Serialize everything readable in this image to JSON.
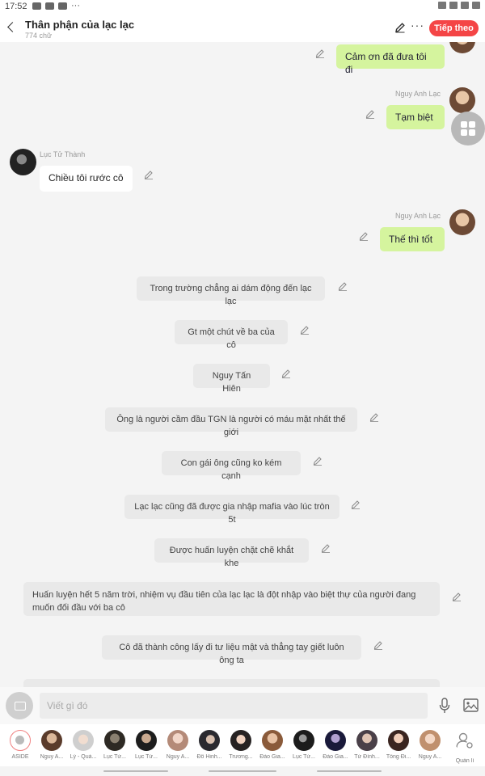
{
  "status_bar": {
    "time": "17:52",
    "more": "···"
  },
  "header": {
    "title": "Thân phận của lạc lạc",
    "word_count": "774 chữ",
    "next_label": "Tiếp theo"
  },
  "chat": {
    "messages": [
      {
        "type": "right",
        "text": "Cảm ơn đã đưa tôi đi"
      },
      {
        "type": "right",
        "speaker": "Nguy Anh Lạc",
        "text": "Tạm biệt"
      },
      {
        "type": "left",
        "speaker": "Lục Tử Thành",
        "text": "Chiều tôi rước cô"
      },
      {
        "type": "right",
        "speaker": "Nguy Anh Lạc",
        "text": "Thế thì tốt"
      },
      {
        "type": "narration",
        "text": "Trong trường chẳng ai dám động đến lạc lạc"
      },
      {
        "type": "narration",
        "text": "Gt một chút về ba của cô"
      },
      {
        "type": "narration",
        "text": "Nguy Tấn Hiên"
      },
      {
        "type": "narration",
        "text": "Ông là người cầm đầu TGN là người có máu mặt nhất thế giới"
      },
      {
        "type": "narration",
        "text": "Con gái ông cũng ko kém cạnh"
      },
      {
        "type": "narration",
        "text": "Lạc lạc cũng đã được gia nhập mafia vào lúc tròn 5t"
      },
      {
        "type": "narration",
        "text": "Được huấn luyện chặt chẽ khắt khe"
      },
      {
        "type": "narration",
        "text": "Huấn luyện hết 5 năm trời, nhiệm vụ đầu tiên của lạc lạc là đột nhập vào biệt thự của người đang muốn đối đầu với ba cô"
      },
      {
        "type": "narration",
        "text": "Cô đã thành công lấy đi tư liệu mật và thẳng tay giết luôn ông ta"
      }
    ]
  },
  "input": {
    "placeholder": "Viết gì đó"
  },
  "characters": [
    {
      "label": "ASIDE"
    },
    {
      "label": "Nguy A..."
    },
    {
      "label": "Lý - Quả..."
    },
    {
      "label": "Lục Tử..."
    },
    {
      "label": "Lục Tử..."
    },
    {
      "label": "Nguy A..."
    },
    {
      "label": "Đỗ Hinh..."
    },
    {
      "label": "Trương..."
    },
    {
      "label": "Đào Gia..."
    },
    {
      "label": "Lục Tử..."
    },
    {
      "label": "Đào Gia..."
    },
    {
      "label": "Tử Đình..."
    },
    {
      "label": "Tống Đi..."
    },
    {
      "label": "Nguy A..."
    },
    {
      "label": "Quản lí"
    }
  ],
  "colors": {
    "accent": "#f44546",
    "right_bubble": "#d5f49e",
    "narration_bubble": "#e9e9e9"
  }
}
